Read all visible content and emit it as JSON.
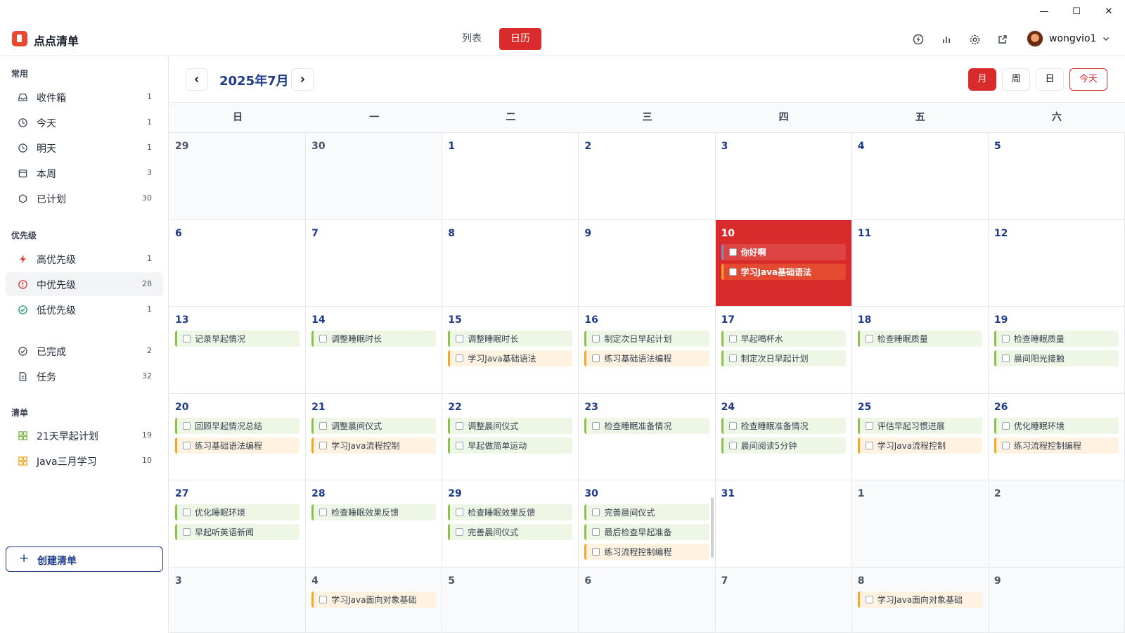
{
  "window": {
    "minimize": "—",
    "maximize": "☐",
    "close": "✕"
  },
  "app": {
    "title": "点点清单"
  },
  "views": {
    "list": "列表",
    "calendar": "日历"
  },
  "user": {
    "name": "wongvio1"
  },
  "sidebar": {
    "common_title": "常用",
    "common": [
      {
        "label": "收件箱",
        "count": "1",
        "icon": "inbox-icon"
      },
      {
        "label": "今天",
        "count": "1",
        "icon": "clock-icon"
      },
      {
        "label": "明天",
        "count": "1",
        "icon": "clock-icon"
      },
      {
        "label": "本周",
        "count": "3",
        "icon": "calendar-icon"
      },
      {
        "label": "已计划",
        "count": "30",
        "icon": "hexagon-icon"
      }
    ],
    "priority_title": "优先级",
    "priority": [
      {
        "label": "高优先级",
        "count": "1",
        "icon": "lightning-icon",
        "color": "#e53935"
      },
      {
        "label": "中优先级",
        "count": "28",
        "icon": "alert-circle-icon",
        "color": "#e53935"
      },
      {
        "label": "低优先级",
        "count": "1",
        "icon": "check-circle-icon",
        "color": "#22a06b"
      }
    ],
    "other": [
      {
        "label": "已完成",
        "count": "2",
        "icon": "check-circle-icon"
      },
      {
        "label": "任务",
        "count": "32",
        "icon": "document-icon"
      }
    ],
    "lists_title": "清单",
    "lists": [
      {
        "label": "21天早起计划",
        "count": "19",
        "icon": "grid-icon",
        "color": "#7cb342"
      },
      {
        "label": "Java三月学习",
        "count": "10",
        "icon": "grid-icon",
        "color": "#f5a623"
      }
    ],
    "create_label": "创建清单"
  },
  "calendar": {
    "month_title": "2025年7月",
    "modes": {
      "month": "月",
      "week": "周",
      "day": "日",
      "today": "今天"
    },
    "weekdays": [
      "日",
      "一",
      "二",
      "三",
      "四",
      "五",
      "六"
    ],
    "weeks": [
      [
        {
          "day": "29",
          "out": true,
          "tasks": []
        },
        {
          "day": "30",
          "out": true,
          "tasks": []
        },
        {
          "day": "1",
          "tasks": []
        },
        {
          "day": "2",
          "tasks": []
        },
        {
          "day": "3",
          "tasks": []
        },
        {
          "day": "4",
          "tasks": []
        },
        {
          "day": "5",
          "tasks": []
        }
      ],
      [
        {
          "day": "6",
          "tasks": []
        },
        {
          "day": "7",
          "tasks": []
        },
        {
          "day": "8",
          "tasks": []
        },
        {
          "day": "9",
          "tasks": []
        },
        {
          "day": "10",
          "today": true,
          "tasks": [
            {
              "title": "你好啊",
              "color": "blue"
            },
            {
              "title": "学习Java基础语法",
              "color": "orange"
            }
          ]
        },
        {
          "day": "11",
          "tasks": []
        },
        {
          "day": "12",
          "tasks": []
        }
      ],
      [
        {
          "day": "13",
          "tasks": [
            {
              "title": "记录早起情况",
              "color": "green"
            }
          ]
        },
        {
          "day": "14",
          "tasks": [
            {
              "title": "调整睡眠时长",
              "color": "green"
            }
          ]
        },
        {
          "day": "15",
          "tasks": [
            {
              "title": "调整睡眠时长",
              "color": "green"
            },
            {
              "title": "学习Java基础语法",
              "color": "orange"
            }
          ]
        },
        {
          "day": "16",
          "tasks": [
            {
              "title": "制定次日早起计划",
              "color": "green"
            },
            {
              "title": "练习基础语法编程",
              "color": "orange"
            }
          ]
        },
        {
          "day": "17",
          "tasks": [
            {
              "title": "早起喝杯水",
              "color": "green"
            },
            {
              "title": "制定次日早起计划",
              "color": "green"
            }
          ]
        },
        {
          "day": "18",
          "tasks": [
            {
              "title": "检查睡眠质量",
              "color": "green"
            }
          ]
        },
        {
          "day": "19",
          "tasks": [
            {
              "title": "检查睡眠质量",
              "color": "green"
            },
            {
              "title": "晨间阳光接触",
              "color": "green"
            }
          ]
        }
      ],
      [
        {
          "day": "20",
          "tasks": [
            {
              "title": "回顾早起情况总结",
              "color": "green"
            },
            {
              "title": "练习基础语法编程",
              "color": "orange"
            }
          ]
        },
        {
          "day": "21",
          "tasks": [
            {
              "title": "调整晨间仪式",
              "color": "green"
            },
            {
              "title": "学习Java流程控制",
              "color": "orange"
            }
          ]
        },
        {
          "day": "22",
          "tasks": [
            {
              "title": "调整晨间仪式",
              "color": "green"
            },
            {
              "title": "早起做简单运动",
              "color": "green"
            }
          ]
        },
        {
          "day": "23",
          "tasks": [
            {
              "title": "检查睡眠准备情况",
              "color": "green"
            }
          ]
        },
        {
          "day": "24",
          "tasks": [
            {
              "title": "检查睡眠准备情况",
              "color": "green"
            },
            {
              "title": "晨间阅读5分钟",
              "color": "green"
            }
          ]
        },
        {
          "day": "25",
          "tasks": [
            {
              "title": "评估早起习惯进展",
              "color": "green"
            },
            {
              "title": "学习Java流程控制",
              "color": "orange"
            }
          ]
        },
        {
          "day": "26",
          "tasks": [
            {
              "title": "优化睡眠环境",
              "color": "green"
            },
            {
              "title": "练习流程控制编程",
              "color": "orange"
            }
          ]
        }
      ],
      [
        {
          "day": "27",
          "tasks": [
            {
              "title": "优化睡眠环境",
              "color": "green"
            },
            {
              "title": "早起听英语新闻",
              "color": "green"
            }
          ]
        },
        {
          "day": "28",
          "tasks": [
            {
              "title": "检查睡眠效果反馈",
              "color": "green"
            }
          ]
        },
        {
          "day": "29",
          "tasks": [
            {
              "title": "检查睡眠效果反馈",
              "color": "green"
            },
            {
              "title": "完善晨间仪式",
              "color": "green"
            }
          ]
        },
        {
          "day": "30",
          "scroll": true,
          "tasks": [
            {
              "title": "完善晨间仪式",
              "color": "green"
            },
            {
              "title": "最后检查早起准备",
              "color": "green"
            },
            {
              "title": "练习流程控制编程",
              "color": "orange"
            }
          ]
        },
        {
          "day": "31",
          "tasks": []
        },
        {
          "day": "1",
          "out": true,
          "tasks": []
        },
        {
          "day": "2",
          "out": true,
          "tasks": []
        }
      ],
      [
        {
          "day": "3",
          "out": true,
          "tasks": []
        },
        {
          "day": "4",
          "out": true,
          "tasks": [
            {
              "title": "学习Java面向对象基础",
              "color": "orange"
            }
          ]
        },
        {
          "day": "5",
          "out": true,
          "tasks": []
        },
        {
          "day": "6",
          "out": true,
          "tasks": []
        },
        {
          "day": "7",
          "out": true,
          "tasks": []
        },
        {
          "day": "8",
          "out": true,
          "tasks": [
            {
              "title": "学习Java面向对象基础",
              "color": "orange"
            }
          ]
        },
        {
          "day": "9",
          "out": true,
          "tasks": []
        }
      ]
    ]
  },
  "colors": {
    "accent": "#d92b2b",
    "title_blue": "#1e3a8a",
    "task_green": "#8bc34a",
    "task_orange": "#f5a623"
  }
}
